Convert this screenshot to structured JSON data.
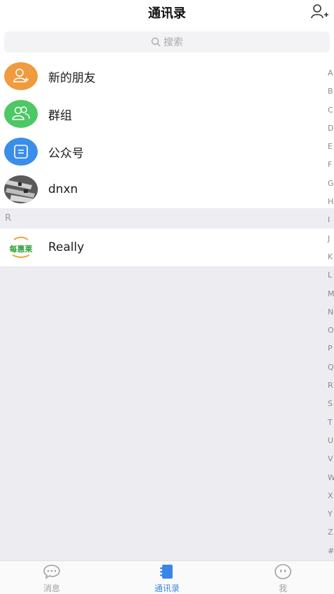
{
  "header": {
    "title": "通讯录"
  },
  "search": {
    "placeholder": "搜索"
  },
  "items": [
    {
      "label": "新的朋友",
      "icon": "add-friend-icon",
      "color": "#ef9b3e"
    },
    {
      "label": "群组",
      "icon": "group-icon",
      "color": "#4cc864"
    },
    {
      "label": "公众号",
      "icon": "official-account-icon",
      "color": "#3a8ee8"
    }
  ],
  "contacts": [
    {
      "name": "dnxn",
      "avatar": "photo-avatar"
    }
  ],
  "sections": [
    {
      "letter": "R",
      "contacts": [
        {
          "name": "Really",
          "avatar_text": "每惠莱"
        }
      ]
    }
  ],
  "index_letters": [
    "A",
    "B",
    "C",
    "D",
    "E",
    "F",
    "G",
    "H",
    "I",
    "J",
    "K",
    "L",
    "M",
    "N",
    "O",
    "P",
    "Q",
    "R",
    "S",
    "T",
    "U",
    "V",
    "W",
    "X",
    "Y",
    "Z",
    "#"
  ],
  "tabs": [
    {
      "label": "消息",
      "icon": "chat-bubble-icon",
      "active": false
    },
    {
      "label": "通讯录",
      "icon": "contacts-book-icon",
      "active": true
    },
    {
      "label": "我",
      "icon": "smiley-face-icon",
      "active": false
    }
  ],
  "colors": {
    "accent": "#3a86e8",
    "orange": "#ef9b3e",
    "green": "#4cc864",
    "blue": "#3a8ee8",
    "brand_green": "#2f9e3a"
  }
}
